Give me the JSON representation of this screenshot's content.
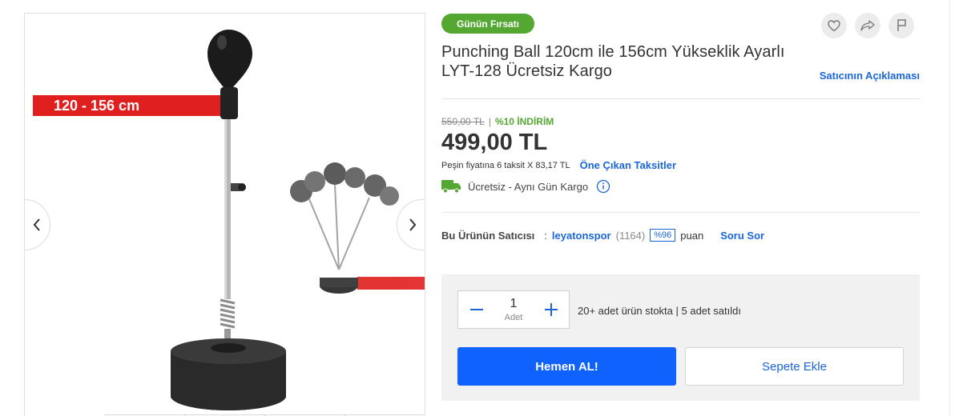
{
  "badge": {
    "label": "Günün Fırsatı",
    "color": "#54a832"
  },
  "title": "Punching Ball 120cm ile 156cm Yükseklik Ayarlı LYT-128 Ücretsiz Kargo",
  "seller_description_link": "Satıcının Açıklaması",
  "gallery": {
    "height_label": "120 - 156 cm",
    "prev_icon": "chevron-left-icon",
    "next_icon": "chevron-right-icon"
  },
  "actions": [
    {
      "icon": "heart-icon",
      "label": "favorite"
    },
    {
      "icon": "share-icon",
      "label": "share"
    },
    {
      "icon": "flag-icon",
      "label": "report"
    }
  ],
  "pricing": {
    "old_price": "550,00 TL",
    "separator": "|",
    "discount": "%10 İNDİRİM",
    "price": "499,00 TL",
    "installment_text": "Peşin fiyatına 6 taksit X 83,17 TL",
    "installment_link": "Öne Çıkan Taksitler"
  },
  "shipping": {
    "text": "Ücretsiz - Aynı Gün Kargo",
    "truck_color": "#54a832"
  },
  "seller": {
    "label": "Bu Ürünün Satıcısı",
    "colon": ":",
    "name": "leyatonspor",
    "review_count": "(1164)",
    "score": "%96",
    "score_label": "puan",
    "ask_link": "Soru Sor"
  },
  "cart": {
    "quantity": "1",
    "unit": "Adet",
    "stock_text": "20+ adet ürün stokta | 5 adet satıldı",
    "buy_now_label": "Hemen AL!",
    "add_to_cart_label": "Sepete Ekle"
  },
  "colors": {
    "accent": "#1a66d9",
    "primary_button": "#0f62fe",
    "green": "#54a832"
  }
}
